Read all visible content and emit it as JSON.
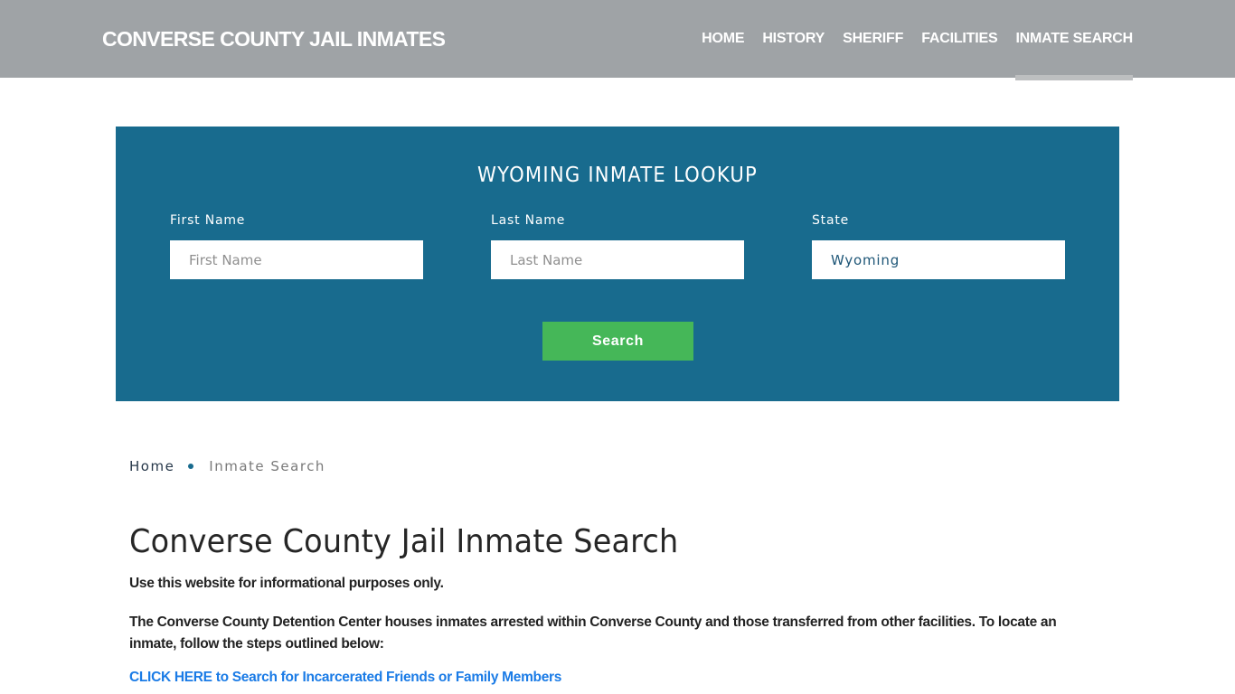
{
  "header": {
    "brand": "CONVERSE COUNTY JAIL INMATES",
    "nav": [
      {
        "label": "HOME",
        "active": false
      },
      {
        "label": "HISTORY",
        "active": false
      },
      {
        "label": "SHERIFF",
        "active": false
      },
      {
        "label": "FACILITIES",
        "active": false
      },
      {
        "label": "INMATE SEARCH",
        "active": true
      }
    ]
  },
  "lookup": {
    "title": "WYOMING INMATE LOOKUP",
    "first_name": {
      "label": "First Name",
      "placeholder": "First Name",
      "value": ""
    },
    "last_name": {
      "label": "Last Name",
      "placeholder": "Last Name",
      "value": ""
    },
    "state": {
      "label": "State",
      "value": "Wyoming"
    },
    "search_label": "Search"
  },
  "breadcrumb": {
    "home": "Home",
    "current": "Inmate Search"
  },
  "content": {
    "title": "Converse County Jail Inmate Search",
    "disclaimer": "Use this website for informational purposes only.",
    "intro": "The Converse County Detention Center houses inmates arrested within Converse County and those transferred from other facilities. To locate an inmate, follow the steps outlined below:",
    "link": "CLICK HERE to Search for Incarcerated Friends or Family Members"
  },
  "colors": {
    "header_bg": "#9fa3a6",
    "lookup_bg": "#186b8e",
    "search_button": "#45b758",
    "link": "#1a7be6"
  }
}
